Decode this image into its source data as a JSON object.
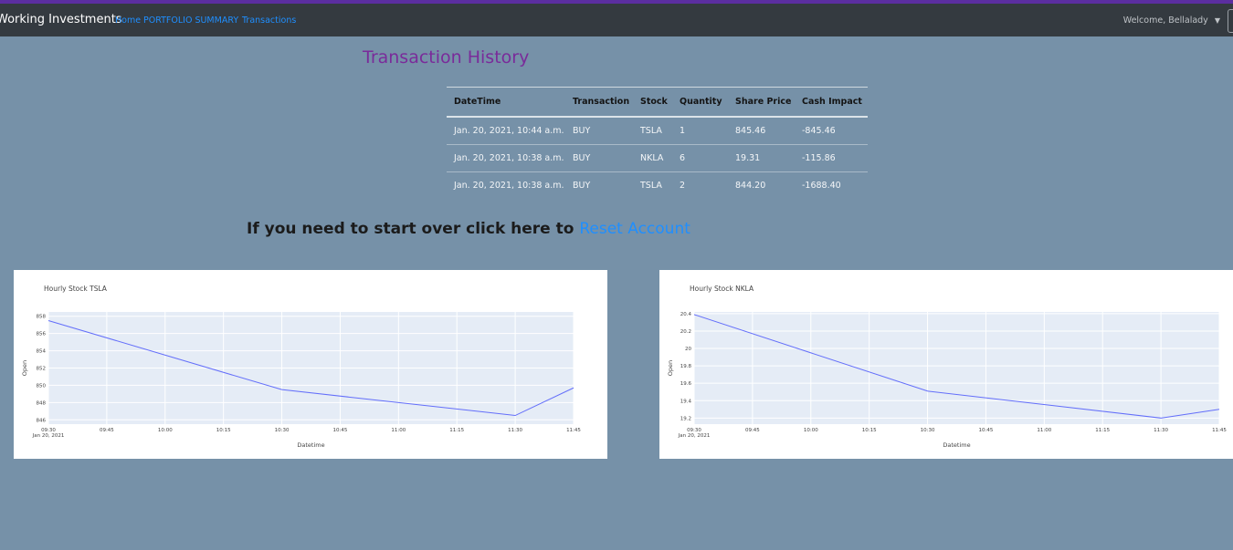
{
  "navbar": {
    "brand": "Working Investments",
    "links": [
      "Home",
      "PORTFOLIO SUMMARY",
      "Transactions"
    ],
    "welcome": "Welcome, Bellalady",
    "caret_icon": "caret-down-icon"
  },
  "page_title": "Transaction History",
  "table": {
    "headers": [
      "DateTime",
      "Transaction",
      "Stock",
      "Quantity",
      "Share Price",
      "Cash Impact"
    ],
    "rows": [
      [
        "Jan. 20, 2021, 10:44 a.m.",
        "BUY",
        "TSLA",
        "1",
        "845.46",
        "-845.46"
      ],
      [
        "Jan. 20, 2021, 10:38 a.m.",
        "BUY",
        "NKLA",
        "6",
        "19.31",
        "-115.86"
      ],
      [
        "Jan. 20, 2021, 10:38 a.m.",
        "BUY",
        "TSLA",
        "2",
        "844.20",
        "-1688.40"
      ]
    ]
  },
  "reset": {
    "prefix": "If you need to start over click here to ",
    "link": "Reset Account"
  },
  "chart_data": [
    {
      "type": "line",
      "title": "Hourly Stock TSLA",
      "xlabel": "Datetime",
      "ylabel": "Open",
      "x": [
        "09:30",
        "10:30",
        "11:30",
        "11:45"
      ],
      "x_ticks": [
        "09:30",
        "09:45",
        "10:00",
        "10:15",
        "10:30",
        "10:45",
        "11:00",
        "11:15",
        "11:30",
        "11:45"
      ],
      "x_date_label": "Jan 20, 2021",
      "y": [
        857.5,
        849.5,
        846.5,
        849.7
      ],
      "y_ticks": [
        846,
        848,
        850,
        852,
        854,
        856,
        858
      ],
      "ylim": [
        845.5,
        858.5
      ],
      "line_color": "#636efa",
      "grid": true
    },
    {
      "type": "line",
      "title": "Hourly Stock NKLA",
      "xlabel": "Datetime",
      "ylabel": "Open",
      "x": [
        "09:30",
        "10:30",
        "11:30",
        "11:45"
      ],
      "x_ticks": [
        "09:30",
        "09:45",
        "10:00",
        "10:15",
        "10:30",
        "10:45",
        "11:00",
        "11:15",
        "11:30",
        "11:45"
      ],
      "x_date_label": "Jan 20, 2021",
      "y": [
        20.39,
        19.51,
        19.2,
        19.3
      ],
      "y_ticks": [
        "19.2",
        "19.4",
        "19.6",
        "19.8",
        "20",
        "20.2",
        "20.4"
      ],
      "ylim": [
        19.13,
        20.42
      ],
      "line_color": "#636efa",
      "grid": true
    }
  ]
}
